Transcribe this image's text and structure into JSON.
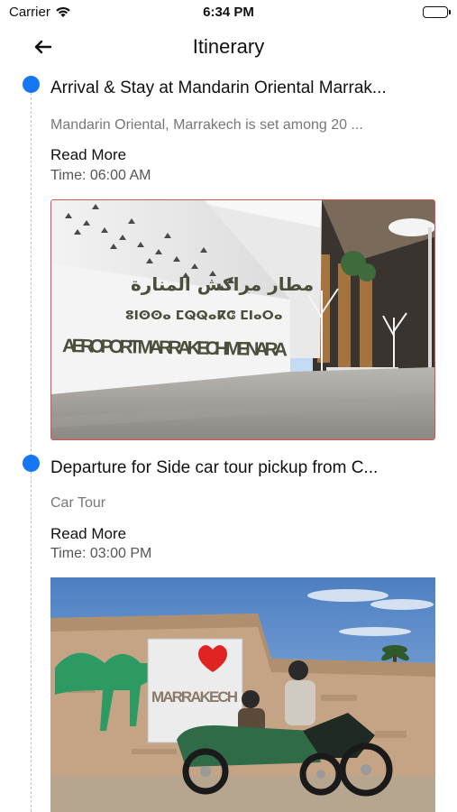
{
  "status_bar": {
    "carrier": "Carrier",
    "time": "6:34 PM"
  },
  "header": {
    "title": "Itinerary",
    "back_icon": "arrow-left-icon"
  },
  "colors": {
    "timeline_dot": "#1677f2",
    "image_border": "#d9534f"
  },
  "items": [
    {
      "title": "Arrival & Stay at Mandarin Oriental Marrak...",
      "description": "Mandarin Oriental, Marrakech is set among 20 ...",
      "read_more": "Read More",
      "time_label": "Time:",
      "time_value": "06:00 AM",
      "image_text": {
        "arabic": "مطار مراكش المنارة",
        "tifinagh": "ⵓⵏⵙⵙⴰ ⵎⵕⵕⴰⴽⵛ ⵎⵏⴰⵔⴰ",
        "latin": "AEROPORT MARRAKECH MENARA"
      }
    },
    {
      "title": "Departure for Side car tour pickup from C...",
      "description": "Car Tour",
      "read_more": "Read More",
      "time_label": "Time:",
      "time_value": "03:00 PM",
      "image_text": {
        "sign": "MARRAKECH"
      }
    }
  ]
}
